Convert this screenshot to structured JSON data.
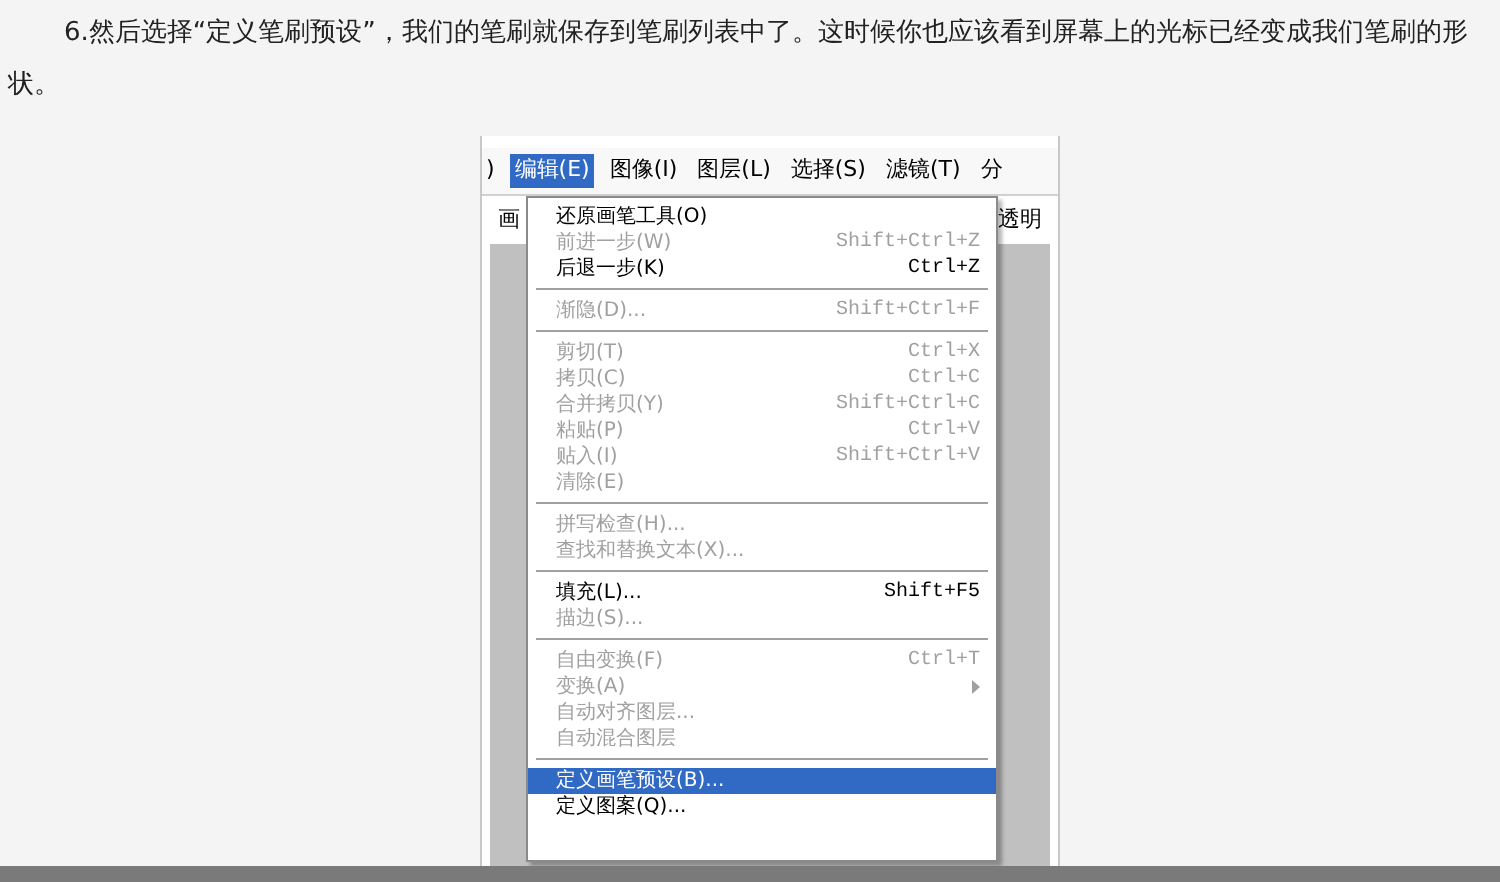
{
  "paragraph": "6.然后选择“定义笔刷预设”，我们的笔刷就保存到笔刷列表中了。这时候你也应该看到屏幕上的光标已经变成我们笔刷的形状。",
  "screenshot": {
    "menubar": [
      {
        "label": ")",
        "selected": false
      },
      {
        "label": "编辑(E)",
        "selected": true
      },
      {
        "label": "图像(I)",
        "selected": false
      },
      {
        "label": "图层(L)",
        "selected": false
      },
      {
        "label": "选择(S)",
        "selected": false
      },
      {
        "label": "滤镜(T)",
        "selected": false
      },
      {
        "label": "分",
        "selected": false
      }
    ],
    "toolbar_left": "画",
    "toolbar_right": "透明",
    "menu": [
      {
        "kind": "item",
        "label": "还原画笔工具(O)",
        "enabled": true,
        "selected": false
      },
      {
        "kind": "item",
        "label": "前进一步(W)",
        "shortcut": "Shift+Ctrl+Z",
        "enabled": false,
        "selected": false
      },
      {
        "kind": "item",
        "label": "后退一步(K)",
        "shortcut": "Ctrl+Z",
        "enabled": true,
        "selected": false
      },
      {
        "kind": "separator"
      },
      {
        "kind": "item",
        "label": "渐隐(D)...",
        "shortcut": "Shift+Ctrl+F",
        "enabled": false,
        "selected": false
      },
      {
        "kind": "separator"
      },
      {
        "kind": "item",
        "label": "剪切(T)",
        "shortcut": "Ctrl+X",
        "enabled": false,
        "selected": false
      },
      {
        "kind": "item",
        "label": "拷贝(C)",
        "shortcut": "Ctrl+C",
        "enabled": false,
        "selected": false
      },
      {
        "kind": "item",
        "label": "合并拷贝(Y)",
        "shortcut": "Shift+Ctrl+C",
        "enabled": false,
        "selected": false
      },
      {
        "kind": "item",
        "label": "粘贴(P)",
        "shortcut": "Ctrl+V",
        "enabled": false,
        "selected": false
      },
      {
        "kind": "item",
        "label": "贴入(I)",
        "shortcut": "Shift+Ctrl+V",
        "enabled": false,
        "selected": false
      },
      {
        "kind": "item",
        "label": "清除(E)",
        "enabled": false,
        "selected": false
      },
      {
        "kind": "separator"
      },
      {
        "kind": "item",
        "label": "拼写检查(H)...",
        "enabled": false,
        "selected": false
      },
      {
        "kind": "item",
        "label": "查找和替换文本(X)...",
        "enabled": false,
        "selected": false
      },
      {
        "kind": "separator"
      },
      {
        "kind": "item",
        "label": "填充(L)...",
        "shortcut": "Shift+F5",
        "enabled": true,
        "selected": false
      },
      {
        "kind": "item",
        "label": "描边(S)...",
        "enabled": false,
        "selected": false
      },
      {
        "kind": "separator"
      },
      {
        "kind": "item",
        "label": "自由变换(F)",
        "shortcut": "Ctrl+T",
        "enabled": false,
        "selected": false
      },
      {
        "kind": "item",
        "label": "变换(A)",
        "enabled": false,
        "selected": false,
        "submenu": true
      },
      {
        "kind": "item",
        "label": "自动对齐图层...",
        "enabled": false,
        "selected": false
      },
      {
        "kind": "item",
        "label": "自动混合图层",
        "enabled": false,
        "selected": false
      },
      {
        "kind": "separator"
      },
      {
        "kind": "item",
        "label": "定义画笔预设(B)...",
        "enabled": true,
        "selected": true
      },
      {
        "kind": "item",
        "label": "定义图案(Q)...",
        "enabled": true,
        "selected": false
      }
    ]
  }
}
